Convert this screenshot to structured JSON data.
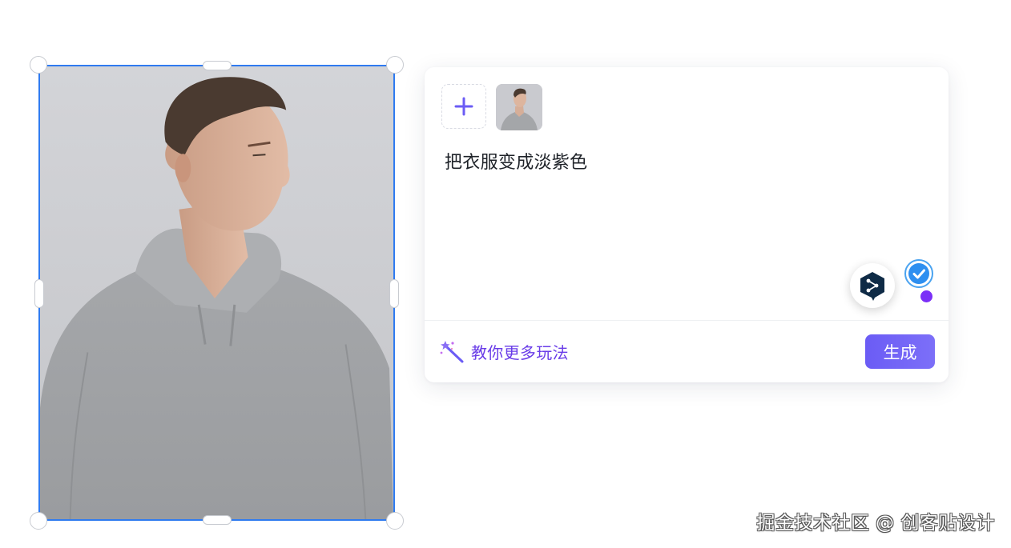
{
  "prompt_card": {
    "add_button_icon": "plus-icon",
    "reference_thumbnail": "man-in-gray-hoodie-photo",
    "prompt_text": "把衣服变成淡紫色",
    "assistant_icon": "deepl-style-hex-icon",
    "badge_icon": "check-circle-icon",
    "tips_icon": "magic-wand-icon",
    "tips_label": "教你更多玩法",
    "generate_label": "生成",
    "accent_color": "#6b5cf5"
  },
  "canvas": {
    "selected_image": "man-in-gray-hoodie-photo",
    "selection_color": "#2f7bf0"
  },
  "watermark": {
    "text": "掘金技术社区 @ 创客贴设计"
  }
}
